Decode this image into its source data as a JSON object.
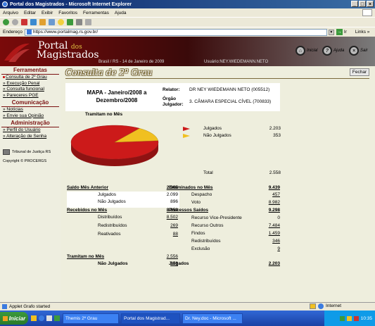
{
  "window": {
    "title": "Portal dos Magistrados - Microsoft Internet Explorer"
  },
  "menu": [
    "Arquivo",
    "Editar",
    "Exibir",
    "Favoritos",
    "Ferramentas",
    "Ajuda"
  ],
  "address": {
    "label": "Endereço",
    "url": "https://www.portalmag.rs.gov.br/",
    "go": "Ir",
    "links": "Links »"
  },
  "header": {
    "brand_line1": "Portal",
    "brand_dos": "dos",
    "brand_line2": "Magistrados",
    "location": "Brasil / RS - 14 de Janeiro de 2009",
    "user": "Usuário:NEY.WIEDEMANN.NETO",
    "btn_inicial": "Inicial",
    "btn_ajuda": "Ajuda",
    "btn_sair": "Sair"
  },
  "sidebar": {
    "ferramentas": "Ferramentas",
    "ferramentas_items": [
      "Consulta de 2º Grau",
      "Execução Penal",
      "Consulta funcional",
      "Pareceres PGE"
    ],
    "comunicacao": "Comunicação",
    "comunicacao_items": [
      "Notícias",
      "Envie sua Opinião"
    ],
    "administracao": "Administração",
    "administracao_items": [
      "Perfil do Usuário",
      "Alteração de Senha"
    ],
    "tribunal": "Tribunal de Justiça RS",
    "copyright": "Copyright © PROCERGS"
  },
  "page": {
    "title": "Consulta de 2º Grau",
    "close_button": "Fechar"
  },
  "mapa": {
    "title": "MAPA - Janeiro/2008 a Dezembro/2008",
    "relator_label": "Relator:",
    "relator_value": "DR NEY WIEDEMANN NETO (005512)",
    "orgao_label": "Órgão Julgador:",
    "orgao_value": "3. CÂMARA ESPECIAL CÍVEL (700833)"
  },
  "chart_data": {
    "type": "pie",
    "title": "Tramitam no Mês",
    "categories": [
      "Julgados",
      "Não Julgados"
    ],
    "values": [
      2203,
      353
    ],
    "colors": [
      "#cc1a1a",
      "#f0c020"
    ],
    "total_label": "Total",
    "total_value": "2.558",
    "value_labels": [
      "2.203",
      "353"
    ]
  },
  "colors": {
    "julgados": "#cc1a1a",
    "nao_julgados": "#f0c020",
    "brand": "#7a1010"
  },
  "stats": {
    "saldo": {
      "label": "Saldo Mês Anterior",
      "total": "2.995",
      "rows": [
        {
          "label": "Julgados",
          "value": "2.099"
        },
        {
          "label": "Não Julgados",
          "value": "896"
        }
      ]
    },
    "recebidos": {
      "label": "Recebidos no Mês",
      "total": "8.859",
      "rows": [
        {
          "label": "Distribuídos",
          "value": "8.502"
        },
        {
          "label": "Redistribuídos",
          "value": "269"
        },
        {
          "label": "Reativados",
          "value": "88"
        }
      ]
    },
    "tramitam": {
      "label": "Tramitam no Mês",
      "total": "2.556",
      "sub_label": "Não Julgados",
      "sub_value": "353"
    },
    "examinados": {
      "label": "Examinados no Mês",
      "total": "9.439",
      "rows": [
        {
          "label": "Despacho",
          "value": "457"
        },
        {
          "label": "Voto",
          "value": "8.982"
        }
      ]
    },
    "processos": {
      "label": "Processos Saídos",
      "total": "9.298",
      "rows": [
        {
          "label": "Recurso Vice-Presidente",
          "value": "0"
        },
        {
          "label": "Recurso Outros",
          "value": "7.484"
        },
        {
          "label": "Findos",
          "value": "1.459"
        },
        {
          "label": "Redistribuídos",
          "value": "346"
        },
        {
          "label": "Exclusão",
          "value": "9"
        }
      ]
    },
    "julgados_label": "Julgados",
    "julgados_value": "2.203"
  },
  "status": {
    "text": "Applet Grafo started",
    "zone": "Internet"
  },
  "taskbar": {
    "start": "Iniciar",
    "tasks": [
      "Themis 2º Grau",
      "Portal dos Magistrad...",
      "Dr. Ney.doc - Microsoft ..."
    ],
    "clock": "10:35"
  }
}
